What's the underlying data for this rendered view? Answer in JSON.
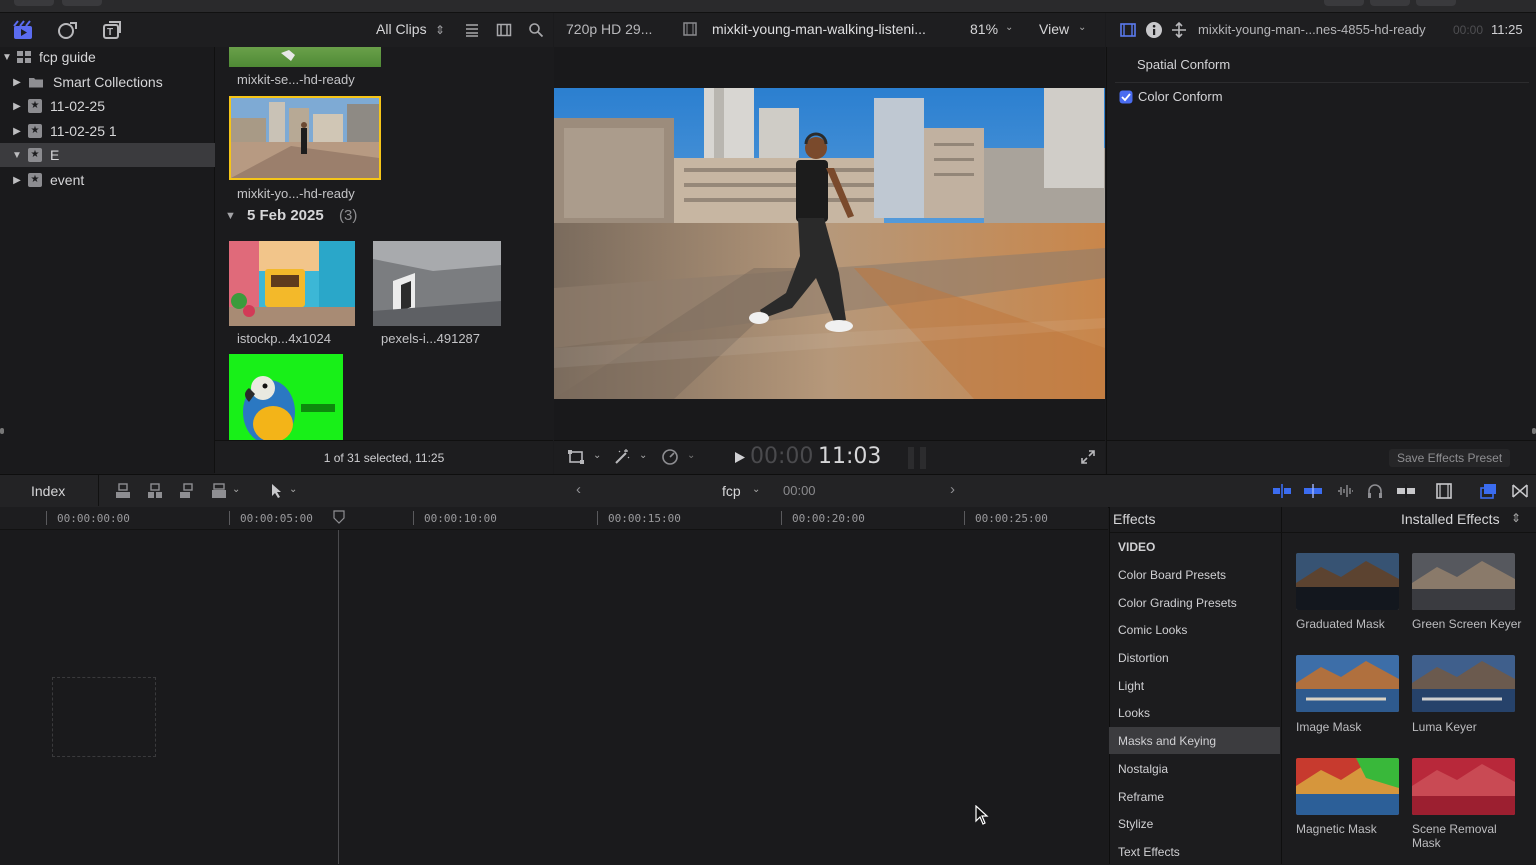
{
  "browser": {
    "filter_label": "All Clips",
    "clips": [
      {
        "name": "mixkit-se...-hd-ready"
      },
      {
        "name": "mixkit-yo...-hd-ready"
      },
      {
        "name": "istockp...4x1024"
      },
      {
        "name": "pexels-i...491287"
      }
    ],
    "date_group": {
      "label": "5 Feb 2025",
      "count": "(3)"
    },
    "status": "1 of 31 selected, 11:25"
  },
  "library": {
    "items": [
      {
        "label": "fcp guide"
      },
      {
        "label": "Smart Collections"
      },
      {
        "label": "11-02-25"
      },
      {
        "label": "11-02-25 1"
      },
      {
        "label": "E"
      },
      {
        "label": "event"
      }
    ]
  },
  "viewer": {
    "format": "720p HD 29...",
    "clip_name": "mixkit-young-man-walking-listeni...",
    "zoom": "81%",
    "view_label": "View",
    "timecode_dim": "00:00",
    "timecode": "11:03"
  },
  "inspector": {
    "clip_name": "mixkit-young-man-...nes-4855-hd-ready",
    "duration_dim": "00:00",
    "duration": "11:25",
    "spatial_conform": "Spatial Conform",
    "color_conform": "Color Conform",
    "color_conform_checked": true,
    "save_preset": "Save Effects Preset"
  },
  "timeline_toolbar": {
    "index_label": "Index",
    "project_name": "fcp",
    "timecode": "00:00"
  },
  "ruler": {
    "ticks": [
      "00:00:00:00",
      "00:00:05:00",
      "00:00:10:00",
      "00:00:15:00",
      "00:00:20:00",
      "00:00:25:00"
    ]
  },
  "effects": {
    "title": "Effects",
    "installed_label": "Installed Effects",
    "categories": [
      {
        "label": "VIDEO"
      },
      {
        "label": "Color Board Presets"
      },
      {
        "label": "Color Grading Presets"
      },
      {
        "label": "Comic Looks"
      },
      {
        "label": "Distortion"
      },
      {
        "label": "Light"
      },
      {
        "label": "Looks"
      },
      {
        "label": "Masks and Keying"
      },
      {
        "label": "Nostalgia"
      },
      {
        "label": "Reframe"
      },
      {
        "label": "Stylize"
      },
      {
        "label": "Text Effects"
      }
    ],
    "selected_category": "Masks and Keying",
    "items": [
      {
        "label": "Graduated Mask",
        "tint": "#2c3a4a"
      },
      {
        "label": "Green Screen Keyer",
        "tint": "#5a5e66"
      },
      {
        "label": "Image Mask",
        "tint": "#3d6ea8"
      },
      {
        "label": "Luma Keyer",
        "tint": "#3f5f8c"
      },
      {
        "label": "Magnetic Mask",
        "tint": "#c73a2e"
      },
      {
        "label": "Scene Removal Mask",
        "tint": "#b8283a"
      }
    ]
  },
  "colors": {
    "accent_blue": "#3b82f6",
    "selection_yellow": "#f5c518",
    "keyer_green": "#18f018"
  }
}
